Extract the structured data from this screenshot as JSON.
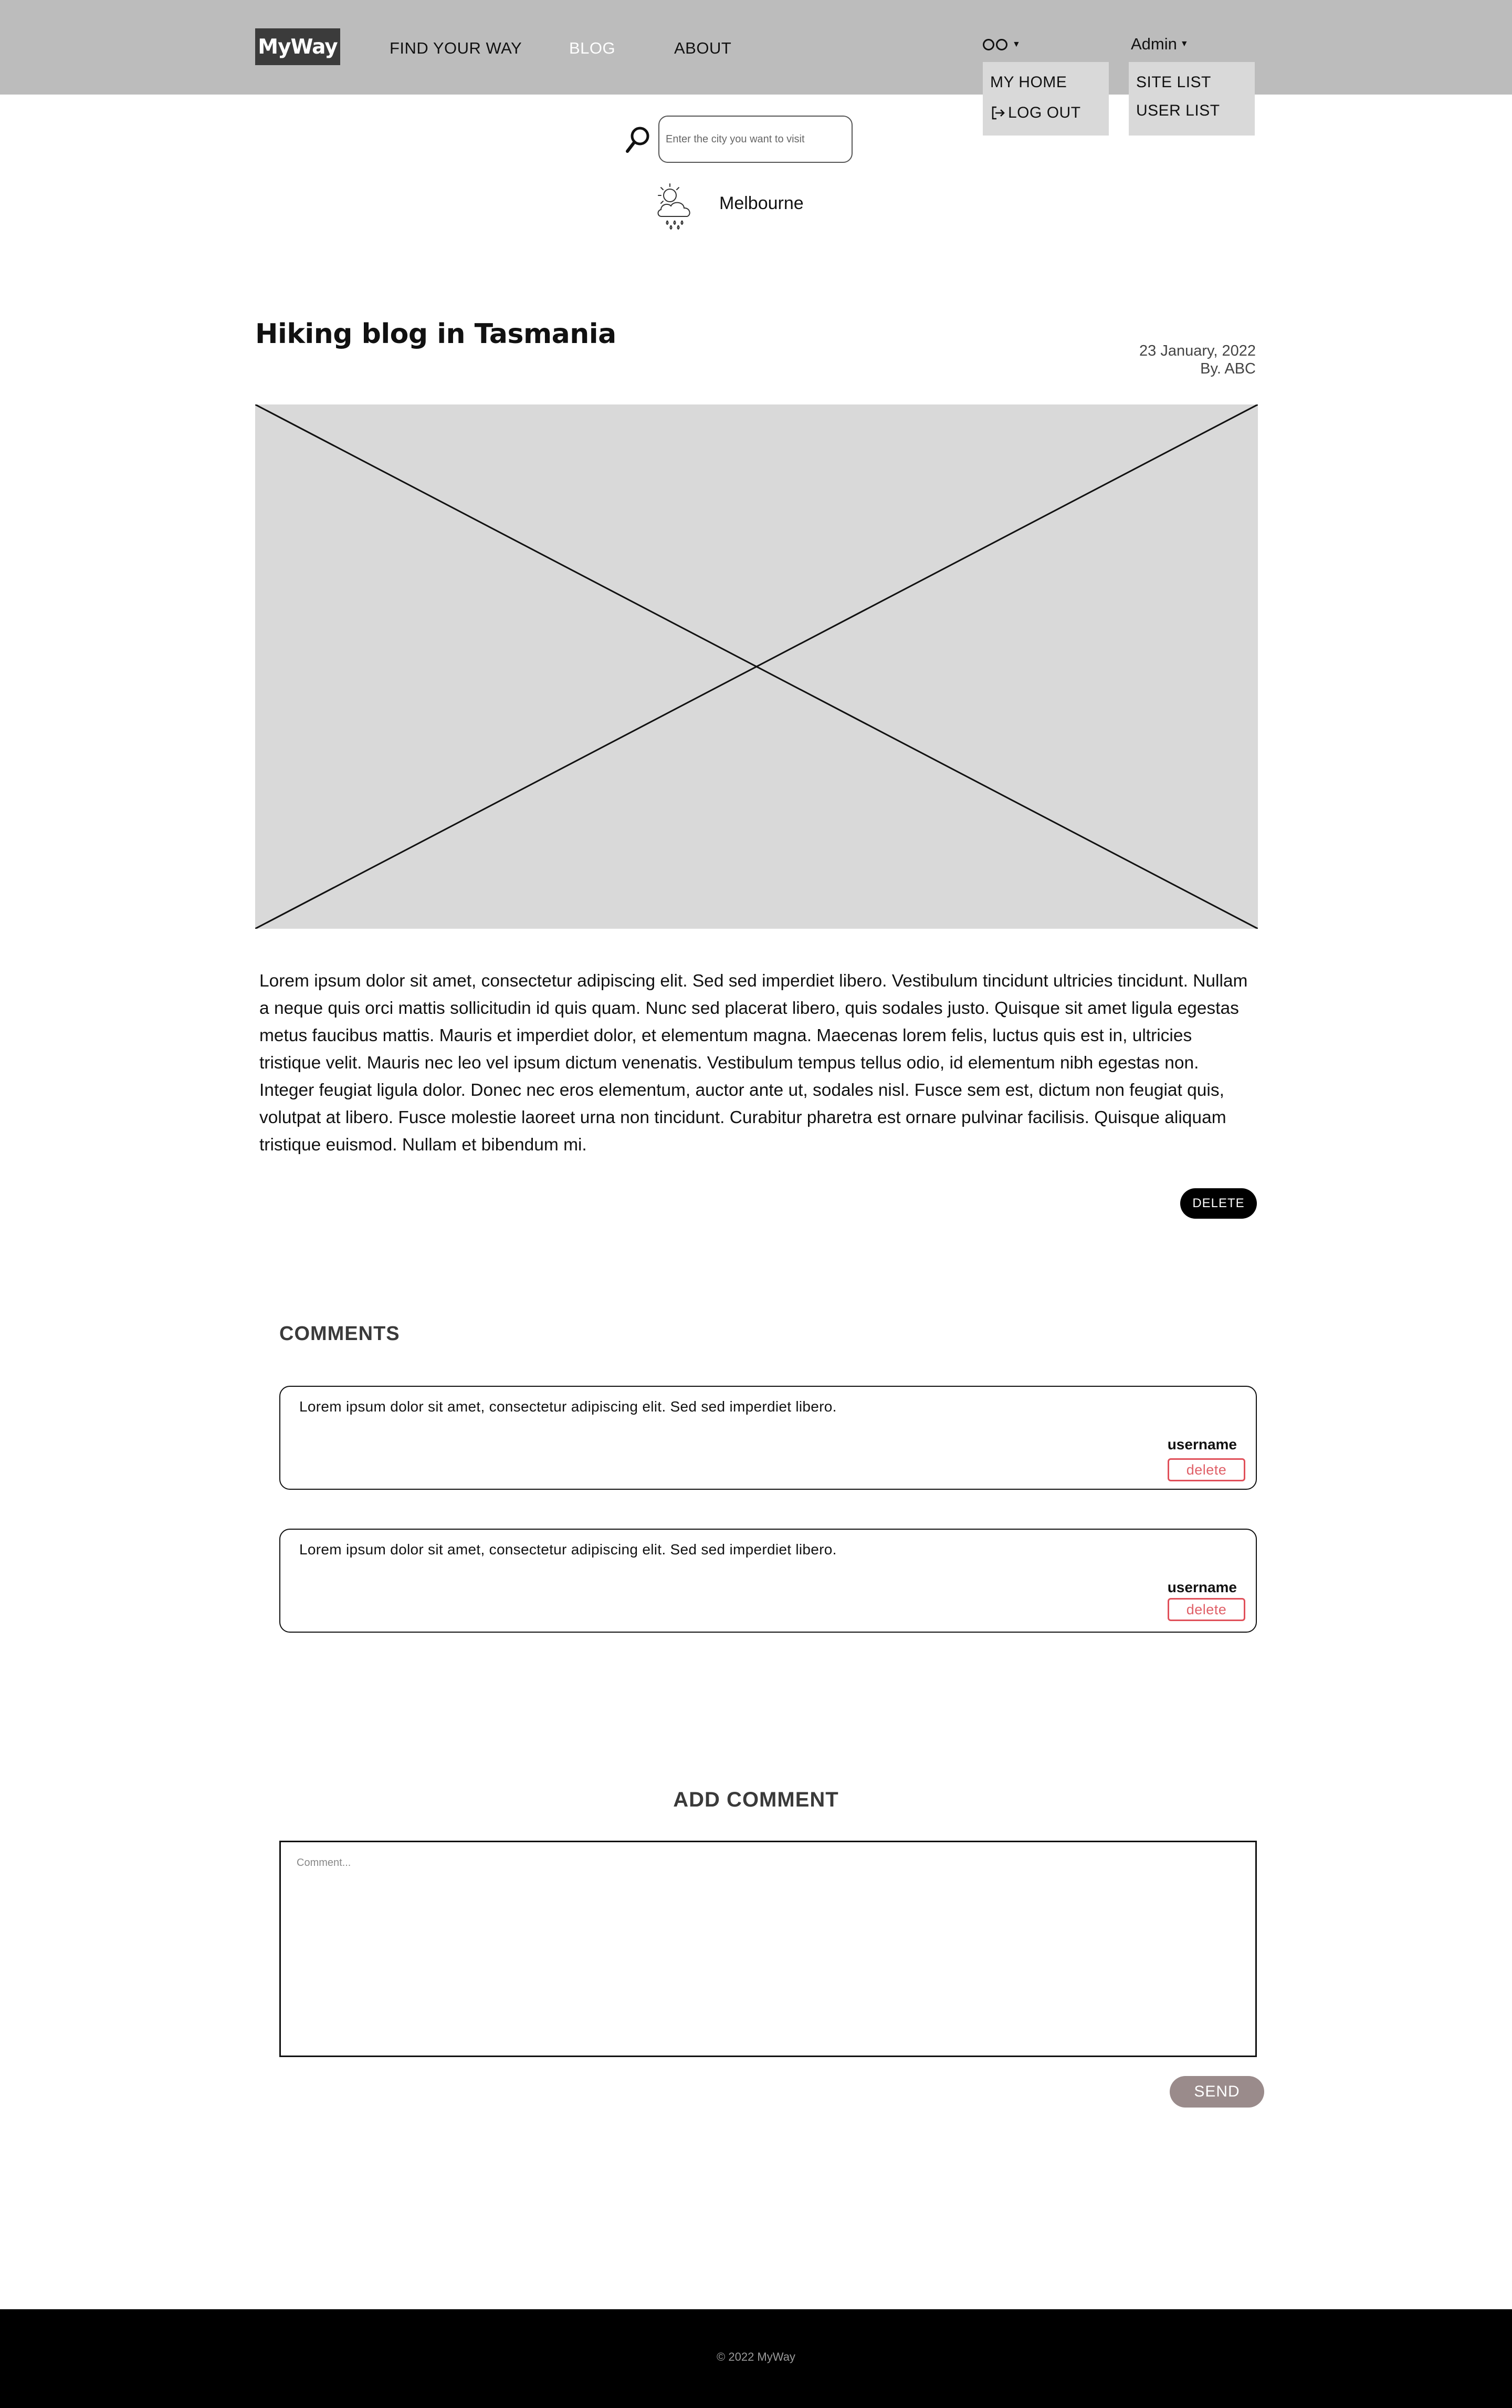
{
  "header": {
    "logo": "MyWay",
    "nav": [
      {
        "label": "FIND YOUR WAY"
      },
      {
        "label": "BLOG",
        "active": true
      },
      {
        "label": "ABOUT"
      }
    ],
    "user_menu": {
      "items": [
        {
          "label": "MY HOME"
        },
        {
          "label": "LOG OUT"
        }
      ]
    },
    "admin_menu": {
      "label": "Admin",
      "items": [
        {
          "label": "SITE LIST"
        },
        {
          "label": "USER LIST"
        }
      ]
    }
  },
  "search": {
    "placeholder": "Enter the city you want to visit"
  },
  "weather": {
    "city": "Melbourne",
    "icon": "cloud-sun-rain-icon"
  },
  "post": {
    "title": "Hiking blog in Tasmania",
    "date": "23 January, 2022",
    "author": "By. ABC",
    "body": "Lorem ipsum dolor sit amet, consectetur adipiscing elit. Sed sed imperdiet libero. Vestibulum tincidunt ultricies tincidunt. Nullam a neque quis orci mattis sollicitudin id quis quam. Nunc sed placerat libero, quis sodales justo. Quisque sit amet ligula egestas metus faucibus mattis. Mauris et imperdiet dolor, et elementum magna. Maecenas lorem felis, luctus quis est in, ultricies tristique velit. Mauris nec leo vel ipsum dictum venenatis. Vestibulum tempus tellus odio, id elementum nibh egestas non. Integer feugiat ligula dolor. Donec nec eros elementum, auctor ante ut, sodales nisl. Fusce sem est, dictum non feugiat quis, volutpat at libero. Fusce molestie laoreet urna non tincidunt. Curabitur pharetra est ornare pulvinar facilisis. Quisque aliquam tristique euismod. Nullam et bibendum mi.",
    "delete_label": "DELETE"
  },
  "comments": {
    "heading": "COMMENTS",
    "items": [
      {
        "text": "Lorem ipsum dolor sit amet, consectetur adipiscing elit. Sed sed imperdiet libero.",
        "username": "username",
        "delete_label": "delete"
      },
      {
        "text": "Lorem ipsum dolor sit amet, consectetur adipiscing elit. Sed sed imperdiet libero.",
        "username": "username",
        "delete_label": "delete"
      }
    ]
  },
  "add_comment": {
    "heading": "ADD COMMENT",
    "placeholder": "Comment...",
    "send_label": "SEND"
  },
  "footer": {
    "copyright": "© 2022 MyWay"
  },
  "colors": {
    "header_bg": "#bcbcbc",
    "dropdown_bg": "#d9d9d9",
    "footer_bg": "#000000",
    "delete_accent": "#e0505a",
    "send_bg": "#9a8b8b"
  }
}
